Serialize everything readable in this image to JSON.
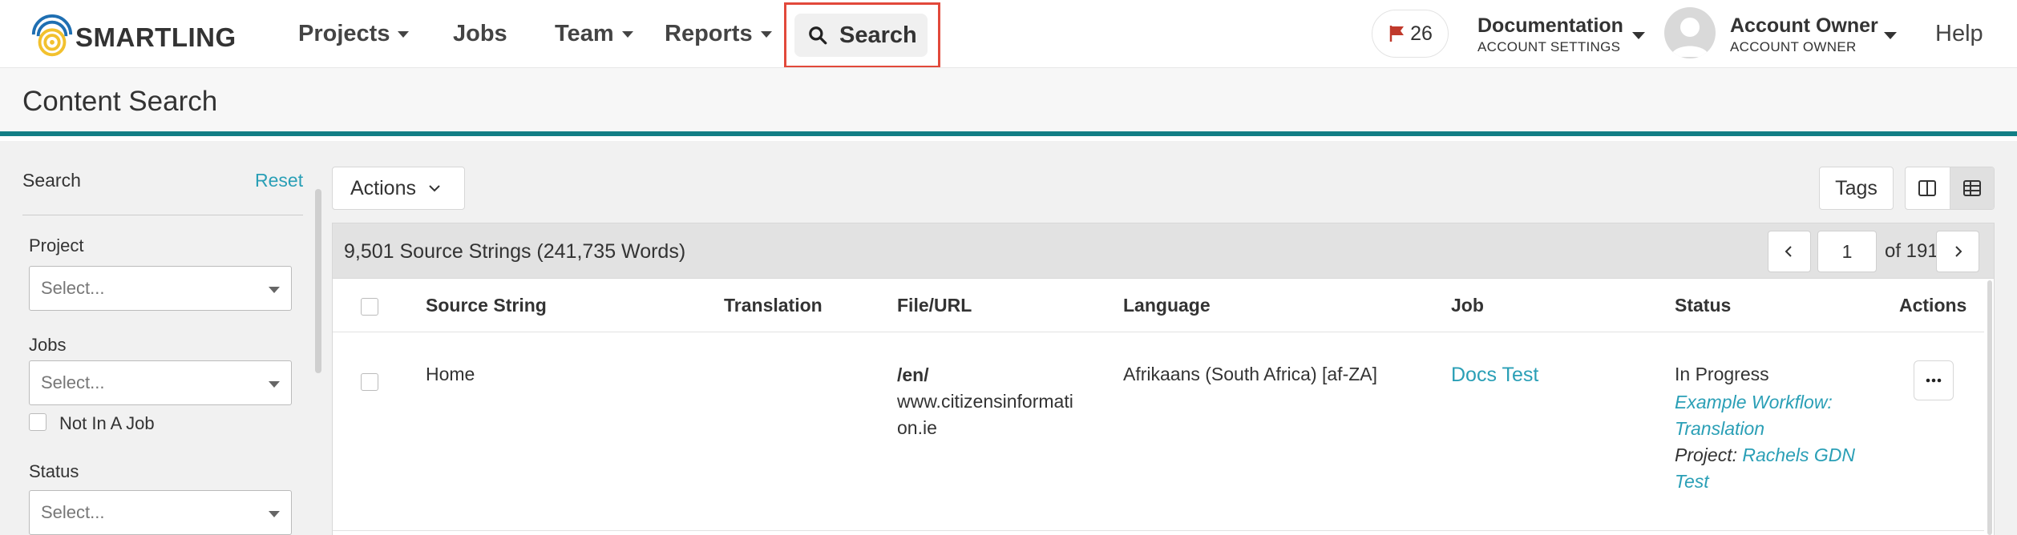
{
  "nav": {
    "logo_text": "SMARTLING",
    "items": [
      {
        "label": "Projects",
        "dropdown": true
      },
      {
        "label": "Jobs",
        "dropdown": false
      },
      {
        "label": "Team",
        "dropdown": true
      },
      {
        "label": "Reports",
        "dropdown": true
      }
    ],
    "search_label": "Search",
    "flag_count": "26",
    "account_settings": {
      "name": "Documentation",
      "sub": "ACCOUNT SETTINGS"
    },
    "account_owner": {
      "name": "Account Owner",
      "sub": "ACCOUNT OWNER"
    },
    "help_label": "Help",
    "highlight_color": "#e2493b",
    "flag_color": "#c0392b"
  },
  "page": {
    "title": "Content Search",
    "accent_color": "#137f86",
    "link_color": "#2a9fb6"
  },
  "sidebar": {
    "title": "Search",
    "reset_label": "Reset",
    "filters": [
      {
        "label": "Project",
        "placeholder": "Select..."
      },
      {
        "label": "Jobs",
        "placeholder": "Select..."
      },
      {
        "label": "Status",
        "placeholder": "Select..."
      }
    ],
    "not_in_job_label": "Not In A Job"
  },
  "toolbar": {
    "actions_label": "Actions",
    "tags_label": "Tags",
    "view_icons": [
      "split-view-icon",
      "table-view-icon"
    ]
  },
  "results": {
    "summary": "9,501 Source Strings (241,735 Words)",
    "page": "1",
    "of_pages": "of 191"
  },
  "table": {
    "columns": [
      "Source String",
      "Translation",
      "File/URL",
      "Language",
      "Job",
      "Status",
      "Actions"
    ],
    "rows": [
      {
        "source": "Home",
        "translation": "",
        "file_path": "/en/",
        "file_host_line1": "www.citizensinformati",
        "file_host_line2": "on.ie",
        "language": "Afrikaans (South Africa) [af-ZA]",
        "job": "Docs Test",
        "status": "In Progress",
        "workflow_line1": "Example Workflow:",
        "workflow_line2": "Translation",
        "project_prefix": "Project:",
        "project_line1": "Rachels GDN",
        "project_line2": "Test"
      }
    ]
  }
}
